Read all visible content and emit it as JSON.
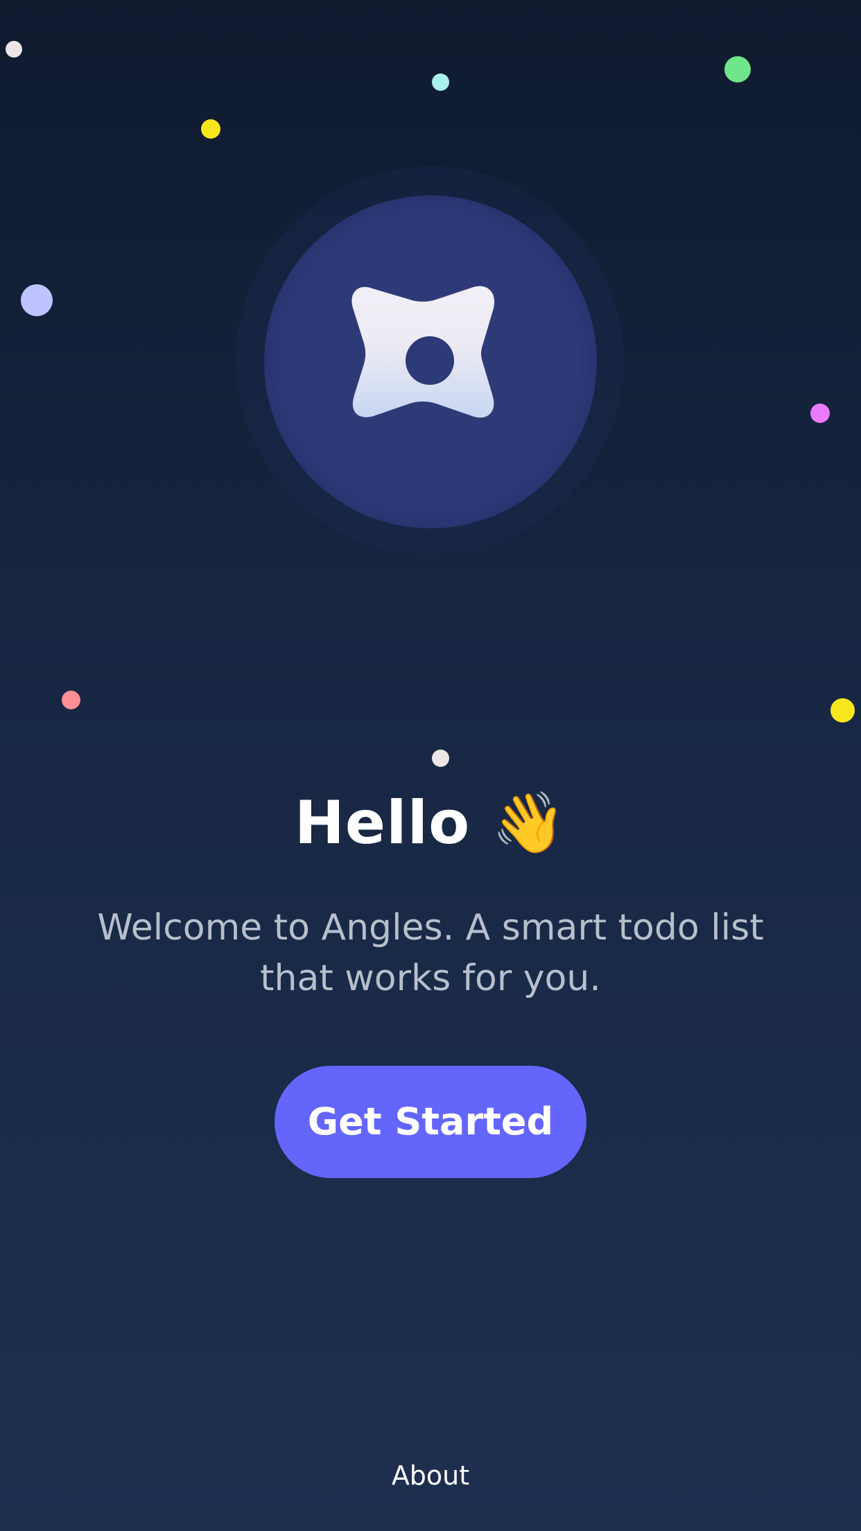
{
  "welcome": {
    "title": "Hello 👋",
    "subtitle": "Welcome to Angles. A smart todo list that works for you.",
    "cta_label": "Get Started",
    "about_label": "About"
  },
  "logo": {
    "icon": "angles-logo-icon"
  },
  "colors": {
    "background_top": "#0f1a2f",
    "background_bottom": "#1e2f50",
    "logo_circle": "#2e3a78",
    "accent": "#6466fb",
    "subtitle_text": "#b8bfcc"
  },
  "decorative_dots": [
    {
      "color": "#ece6e6"
    },
    {
      "color": "#a8f0ee"
    },
    {
      "color": "#6fe68a"
    },
    {
      "color": "#f8e71c"
    },
    {
      "color": "#bfc3ff"
    },
    {
      "color": "#ea7bff"
    },
    {
      "color": "#ff8e96"
    },
    {
      "color": "#f8e71c"
    },
    {
      "color": "#ece6e6"
    }
  ]
}
